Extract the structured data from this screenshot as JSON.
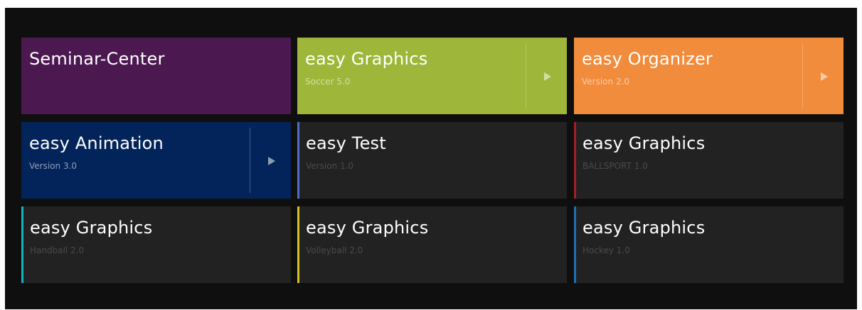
{
  "tiles": [
    {
      "title": "Seminar-Center",
      "subtitle": "",
      "bg": "#4b1850",
      "arrow": false
    },
    {
      "title": "easy Graphics",
      "subtitle": "Soccer 5.0",
      "bg": "#9eb73a",
      "arrow": true
    },
    {
      "title": "easy Organizer",
      "subtitle": "Version 2.0",
      "bg": "#f28c3d",
      "arrow": true
    },
    {
      "title": "easy Animation",
      "subtitle": "Version 3.0",
      "bg": "#02245a",
      "arrow": true
    },
    {
      "title": "easy Test",
      "subtitle": "Version 1.0",
      "accent": "#4f6fc6"
    },
    {
      "title": "easy Graphics",
      "subtitle": "BALLSPORT 1.0",
      "accent": "#a41f26"
    },
    {
      "title": "easy Graphics",
      "subtitle": "Handball 2.0",
      "accent": "#18b2b8"
    },
    {
      "title": "easy Graphics",
      "subtitle": "Volleyball 2.0",
      "accent": "#d8c01c"
    },
    {
      "title": "easy Graphics",
      "subtitle": "Hockey 1.0",
      "accent": "#1a72b8"
    }
  ]
}
